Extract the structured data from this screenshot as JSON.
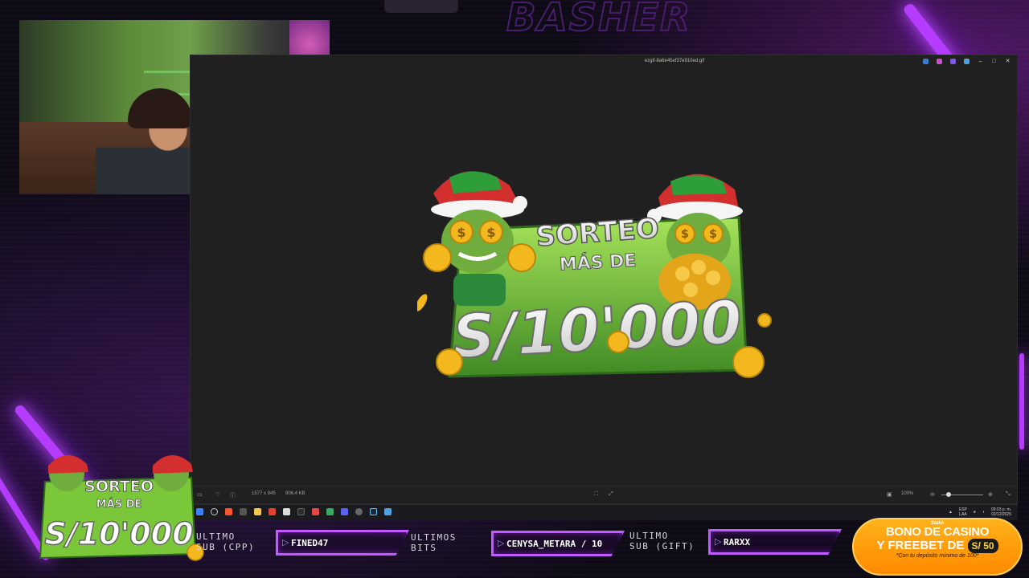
{
  "viewer": {
    "window_title": "ezgif-8a6e45ef37e910ed.gif",
    "image_dimensions": "1577 x 945",
    "file_size": "906.4 KB",
    "zoom_level": "100%"
  },
  "promo_image": {
    "line1": "SORTEO",
    "line2": "MÁS DE",
    "amount": "S/10'000"
  },
  "overlay_logo": {
    "line1": "SORTEO",
    "line2": "MÁS DE",
    "amount": "S/10'000"
  },
  "alerts": {
    "sub_cpp_label_1": "ULTIMO",
    "sub_cpp_label_2": "SUB (CPP)",
    "sub_cpp_name": "FINED47",
    "bits_label_1": "ULTIMOS",
    "bits_label_2": "BITS",
    "bits_name": "CENYSA_METARA / 10",
    "sub_gift_label_1": "ULTIMO",
    "sub_gift_label_2": "SUB (GIFT)",
    "sub_gift_name": "RARXX"
  },
  "casino_promo": {
    "brand": "Stake",
    "line1": "BONO DE CASINO",
    "line2": "Y FREEBET DE",
    "amount": "S/ 50",
    "note": "*Con tu depósito mínimo de 100*"
  },
  "tray": {
    "lang_top": "ESP",
    "lang_bottom": "LAA",
    "time": "09:03 p. m.",
    "date": "02/12/2025"
  },
  "colors": {
    "neon": "#c05cff",
    "promo_orange": "#ff9a00",
    "sign_green": "#7ac83a",
    "gold": "#f2b81e"
  },
  "icons": [
    "heart-icon",
    "info-icon",
    "search-icon",
    "file-explorer-icon",
    "chrome-icon",
    "steam-icon",
    "zoom-out-icon",
    "zoom-in-icon",
    "fit-icon",
    "fullscreen-icon",
    "minimize-icon",
    "maximize-icon",
    "close-icon"
  ]
}
